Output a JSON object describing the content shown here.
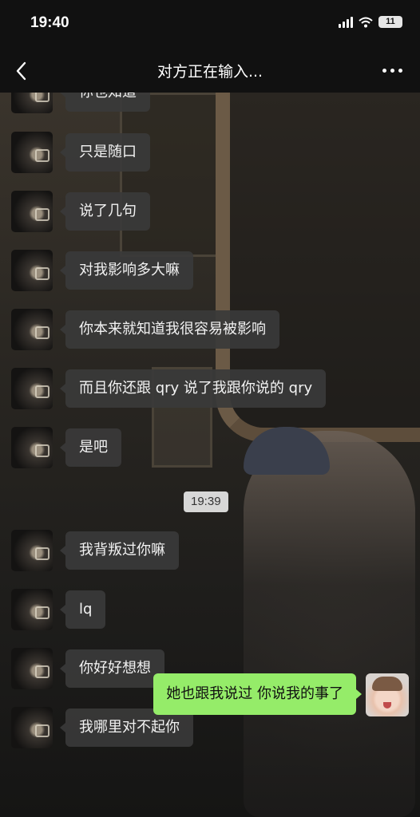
{
  "status_bar": {
    "time": "19:40",
    "battery": "11"
  },
  "header": {
    "title": "对方正在输入...",
    "back_icon": "back-chevron-icon",
    "more_icon": "more-dots-icon"
  },
  "chat": {
    "messages": [
      {
        "sender": "other",
        "text": "你也知道"
      },
      {
        "sender": "other",
        "text": "只是随口"
      },
      {
        "sender": "other",
        "text": "说了几句"
      },
      {
        "sender": "other",
        "text": "对我影响多大嘛"
      },
      {
        "sender": "other",
        "text": "你本来就知道我很容易被影响"
      },
      {
        "sender": "other",
        "text": "而且你还跟 qry 说了我跟你说的 qry"
      },
      {
        "sender": "other",
        "text": "是吧"
      },
      {
        "sender": "other",
        "text": "我背叛过你嘛"
      },
      {
        "sender": "other",
        "text": "lq"
      },
      {
        "sender": "other",
        "text": "你好好想想"
      },
      {
        "sender": "other",
        "text": "我哪里对不起你"
      }
    ],
    "timestamp": "19:39",
    "self_message": "她也跟我说过 你说我的事了"
  },
  "colors": {
    "self_bubble": "#95ec69",
    "other_bubble": "#3a3a3a",
    "bar": "#111111"
  }
}
